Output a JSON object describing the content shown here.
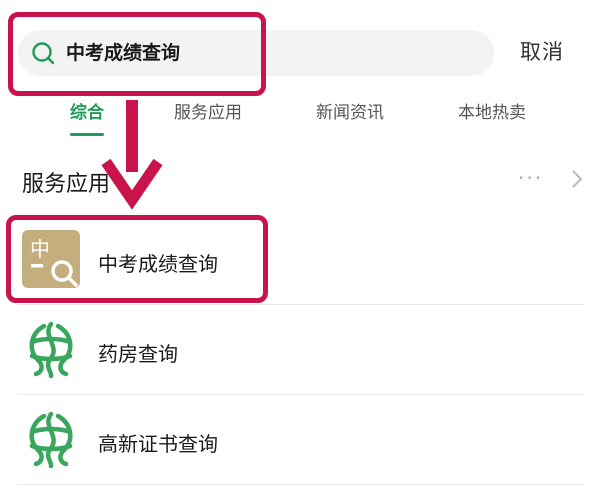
{
  "search": {
    "query": "中考成绩查询",
    "cancel_label": "取消"
  },
  "tabs": [
    {
      "label": "综合",
      "active": true
    },
    {
      "label": "服务应用",
      "active": false
    },
    {
      "label": "新闻资讯",
      "active": false
    },
    {
      "label": "本地热卖",
      "active": false
    }
  ],
  "section": {
    "title": "服务应用",
    "more": "···"
  },
  "results": [
    {
      "label": "中考成绩查询",
      "icon": "exam-score-search-icon",
      "icon_text": "中"
    },
    {
      "label": "药房查询",
      "icon": "green-service-logo-icon"
    },
    {
      "label": "高新证书查询",
      "icon": "green-service-logo-icon"
    }
  ],
  "colors": {
    "accent": "#1f9c57",
    "highlight": "#c8144b",
    "exam_icon_bg": "#c4ae7e"
  }
}
